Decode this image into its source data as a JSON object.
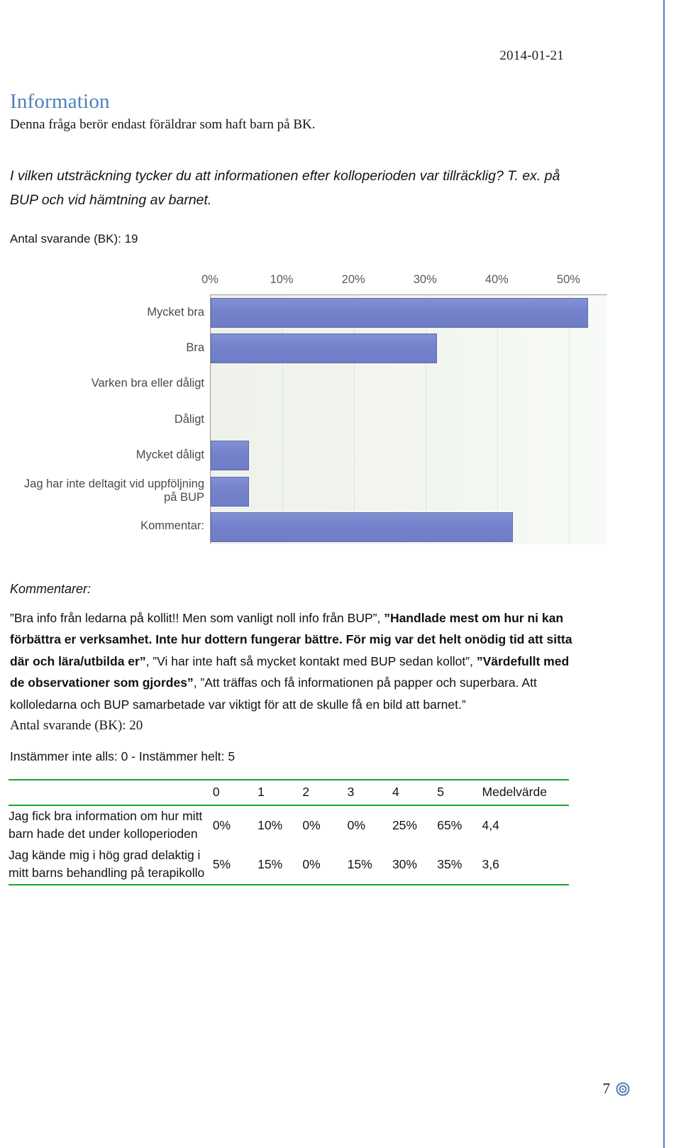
{
  "document": {
    "date": "2014-01-21",
    "page_number": "7",
    "footer_icon": "bullseye-icon",
    "accent_color": "#4e80b8",
    "table_rule_color": "#17a533",
    "bar_color": "#7582cb"
  },
  "section": {
    "title": "Information",
    "intro": "Denna fråga berör endast föräldrar som haft barn på BK.",
    "question": "I vilken utsträckning tycker du att informationen efter kolloperioden var tillräcklig? T. ex. på BUP och vid hämtning av barnet.",
    "respondents": "Antal svarande (BK): 19"
  },
  "chart_data": {
    "type": "bar",
    "orientation": "horizontal",
    "title": "",
    "xlabel": "",
    "ylabel": "",
    "xlim": [
      0,
      55.4
    ],
    "grid": true,
    "legend": false,
    "tick_labels": [
      "0%",
      "10%",
      "20%",
      "30%",
      "40%",
      "50%"
    ],
    "ticks": [
      0,
      10,
      20,
      30,
      40,
      50
    ],
    "categories": [
      "Mycket bra",
      "Bra",
      "Varken bra eller dåligt",
      "Dåligt",
      "Mycket dåligt",
      "Jag har inte deltagit vid uppföljning\npå BUP",
      "Kommentar:"
    ],
    "values": [
      52.6,
      31.6,
      0,
      0,
      5.3,
      5.3,
      42.1
    ]
  },
  "comments": {
    "heading": "Kommentarer:",
    "segments": [
      {
        "text": "”Bra info från ledarna på kollit!! Men som vanligt noll info från BUP”, ",
        "bold": false
      },
      {
        "text": "”Handlade mest om hur ni kan förbättra er verksamhet. Inte hur dottern fungerar bättre. För mig var det helt onödig tid att sitta där och lära/utbilda er”",
        "bold": true
      },
      {
        "text": ", ”Vi har inte haft så mycket kontakt med BUP sedan kollot”, ",
        "bold": false
      },
      {
        "text": "”Värdefullt med de observationer som gjordes”",
        "bold": true
      },
      {
        "text": ", ”Att träffas och få informationen på papper och superbara. Att kolloledarna och BUP samarbetade var viktigt för att de skulle få en bild att barnet.”",
        "bold": false
      }
    ]
  },
  "survey": {
    "respondents": "Antal svarande (BK): 20",
    "scale_note": "Instämmer inte alls: 0 - Instämmer helt: 5",
    "table": {
      "headers": [
        "",
        "0",
        "1",
        "2",
        "3",
        "4",
        "5",
        "Medelvärde"
      ],
      "rows": [
        {
          "label": "Jag fick bra information om hur mitt barn hade det under kolloperioden",
          "values": [
            "0%",
            "10%",
            "0%",
            "0%",
            "25%",
            "65%"
          ],
          "mean": "4,4"
        },
        {
          "label": "Jag kände mig i hög grad delaktig i mitt barns behandling på terapikollo",
          "values": [
            "5%",
            "15%",
            "0%",
            "15%",
            "30%",
            "35%"
          ],
          "mean": "3,6"
        }
      ]
    }
  }
}
